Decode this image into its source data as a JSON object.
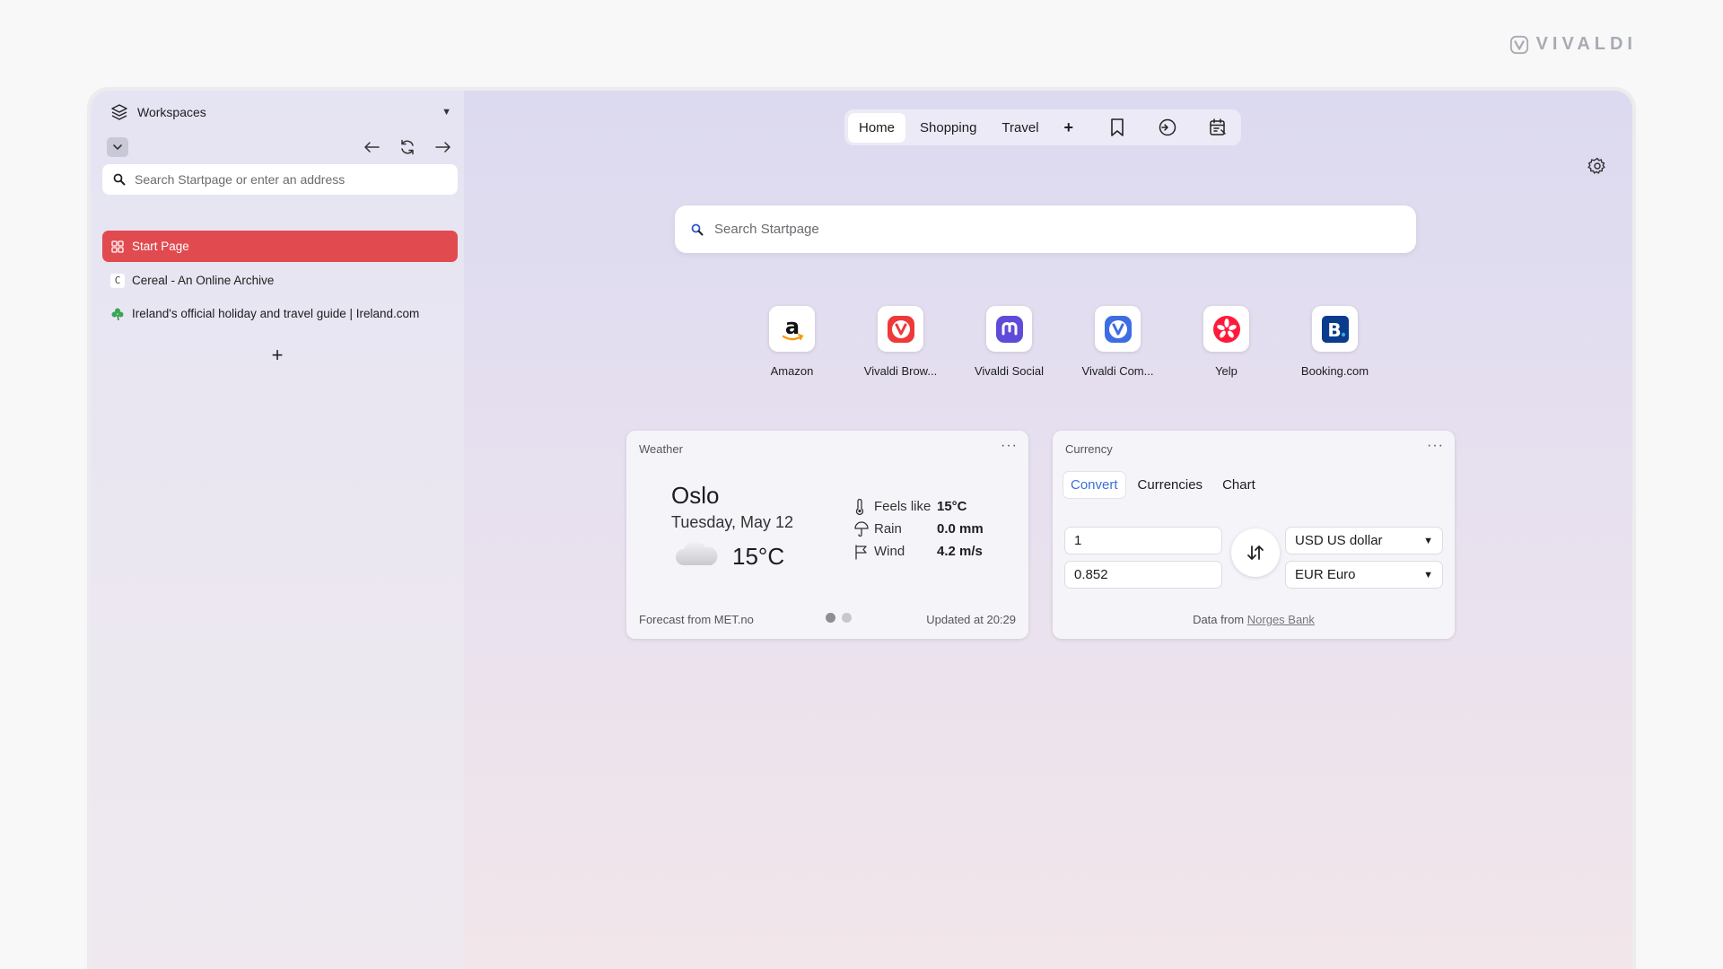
{
  "brand": {
    "name": "VIVALDI"
  },
  "sidebar": {
    "workspaces_label": "Workspaces",
    "address_placeholder": "Search Startpage or enter an address",
    "tabs": [
      {
        "title": "Start Page",
        "icon": "grid-icon",
        "active": true
      },
      {
        "title": "Cereal - An Online Archive",
        "icon": "c-favicon",
        "favicon_text": "C",
        "active": false
      },
      {
        "title": "Ireland's official holiday and travel guide | Ireland.com",
        "icon": "shamrock-icon",
        "active": false
      }
    ],
    "new_tab_label": "+"
  },
  "startpage": {
    "tabs": [
      "Home",
      "Shopping",
      "Travel"
    ],
    "active_tab": "Home",
    "add_label": "+",
    "search_placeholder": "Search Startpage",
    "speed_dials": [
      {
        "label": "Amazon",
        "icon": "amazon-icon",
        "color": "#111111"
      },
      {
        "label": "Vivaldi Brow...",
        "icon": "vivaldi-icon",
        "color": "#ef3939"
      },
      {
        "label": "Vivaldi Social",
        "icon": "mastodon-icon",
        "color": "#5e4bd9"
      },
      {
        "label": "Vivaldi Com...",
        "icon": "vivaldi-community-icon",
        "color": "#3e6de3"
      },
      {
        "label": "Yelp",
        "icon": "yelp-icon",
        "color": "#ff1a1a"
      },
      {
        "label": "Booking.com",
        "icon": "booking-icon",
        "color": "#0b3b8c",
        "text": "B."
      }
    ]
  },
  "weather": {
    "title": "Weather",
    "more": "···",
    "city": "Oslo",
    "date": "Tuesday, May 12",
    "temperature": "15°C",
    "rows": [
      {
        "label": "Feels like",
        "value": "15°C"
      },
      {
        "label": "Rain",
        "value": "0.0 mm"
      },
      {
        "label": "Wind",
        "value": "4.2 m/s"
      }
    ],
    "forecast_source": "Forecast from MET.no",
    "updated": "Updated at 20:29"
  },
  "currency": {
    "title": "Currency",
    "more": "···",
    "tabs": [
      "Convert",
      "Currencies",
      "Chart"
    ],
    "active_tab": "Convert",
    "amount_from": "1",
    "amount_to": "0.852",
    "currency_from": "USD US dollar",
    "currency_to": "EUR Euro",
    "footer_prefix": "Data from",
    "footer_link": "Norges Bank"
  },
  "colors": {
    "active_tab": "#e14a4f",
    "accent_blue": "#3b6fd8"
  }
}
